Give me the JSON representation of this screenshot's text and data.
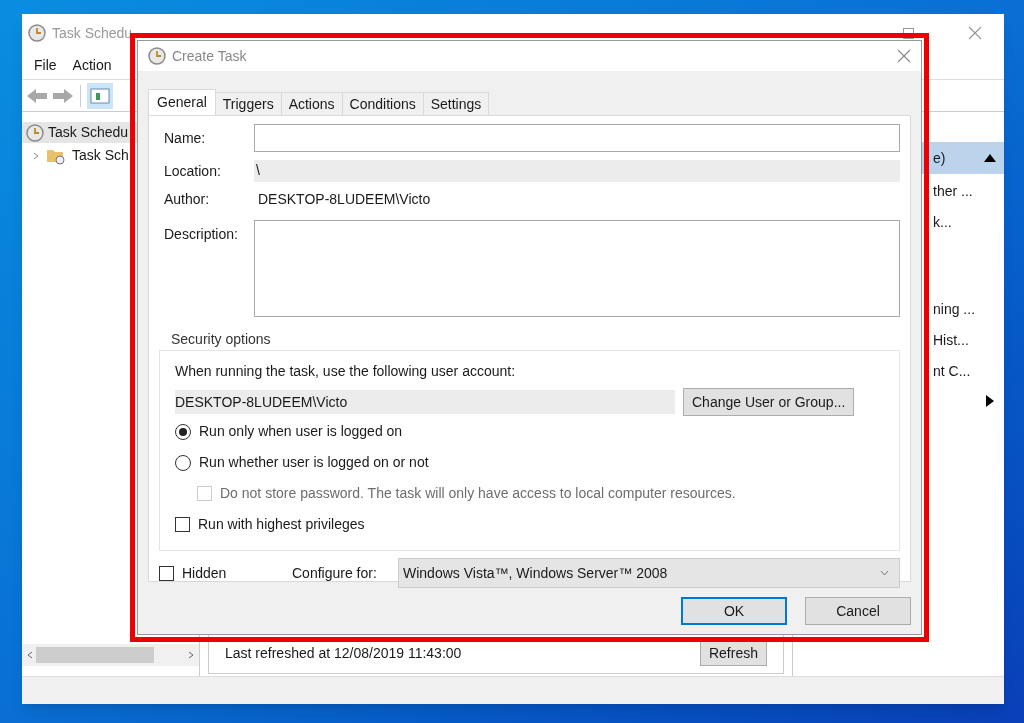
{
  "background_window": {
    "title": "Task Schedu",
    "menu": [
      "File",
      "Action"
    ],
    "tree": [
      {
        "label": "Task Schedu",
        "children": [
          {
            "label": "Task Sch",
            "expanded": false
          }
        ]
      }
    ],
    "actions_pane": {
      "header": "e)",
      "groups": [
        [
          "ther ...",
          "k..."
        ],
        [
          "ning ...",
          "Hist...",
          "nt C..."
        ]
      ],
      "submenu_arrow": true
    },
    "status": "Last refreshed at 12/08/2019 11:43:00",
    "refresh_button": "Refresh"
  },
  "dialog": {
    "title": "Create Task",
    "tabs": [
      {
        "label": "General",
        "selected": true
      },
      {
        "label": "Triggers",
        "selected": false
      },
      {
        "label": "Actions",
        "selected": false
      },
      {
        "label": "Conditions",
        "selected": false
      },
      {
        "label": "Settings",
        "selected": false
      }
    ],
    "name_label": "Name:",
    "location_label": "Location:",
    "location": "\\",
    "author_label": "Author:",
    "author": "DESKTOP-8LUDEEM\\Victo",
    "description_label": "Description:",
    "security": {
      "legend": "Security options",
      "account_prompt": "When running the task, use the following user account:",
      "account": "DESKTOP-8LUDEEM\\Victo",
      "change_button": "Change User or Group...",
      "options": [
        {
          "kind": "radio",
          "label": "Run only when user is logged on",
          "selected": true,
          "disabled": false,
          "indent": false
        },
        {
          "kind": "radio",
          "label": "Run whether user is logged on or not",
          "selected": false,
          "disabled": false,
          "indent": false
        },
        {
          "kind": "checkbox",
          "label": "Do not store password.  The task will only have access to local computer resources.",
          "checked": false,
          "disabled": true,
          "indent": true
        },
        {
          "kind": "checkbox",
          "label": "Run with highest privileges",
          "checked": false,
          "disabled": false,
          "indent": false
        }
      ]
    },
    "hidden": {
      "label": "Hidden",
      "checked": false
    },
    "configure_label": "Configure for:",
    "configure_value": "Windows Vista™, Windows Server™ 2008",
    "buttons": [
      {
        "label": "OK",
        "default": true
      },
      {
        "label": "Cancel",
        "default": false
      }
    ]
  }
}
